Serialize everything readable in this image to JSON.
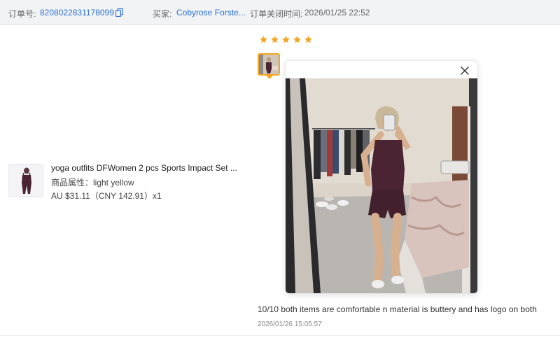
{
  "order": {
    "number_label": "订单号:",
    "number_value": "8208022831178099",
    "buyer_label": "买家:",
    "buyer_value": "Cobyrose Forste...",
    "close_time_label": "订单关闭时间:",
    "close_time_value": "2026/01/25 22:52"
  },
  "product": {
    "title": "yoga outfits DFWomen 2 pcs Sports Impact Set ...",
    "attribute": "商品属性：light yellow",
    "price": "AU $31.11（CNY  142.91）x1"
  },
  "review": {
    "rating": 5,
    "rating_max": 5,
    "text": "10/10 both items are comfortable n material is buttery and has logo on both",
    "time": "2026/01/26 15:05:57"
  },
  "colors": {
    "link": "#2a6fd6",
    "star": "#f5a623",
    "topbar_bg": "#f2f3f5"
  },
  "icons": [
    "copy-icon",
    "star-icon",
    "close-icon"
  ]
}
